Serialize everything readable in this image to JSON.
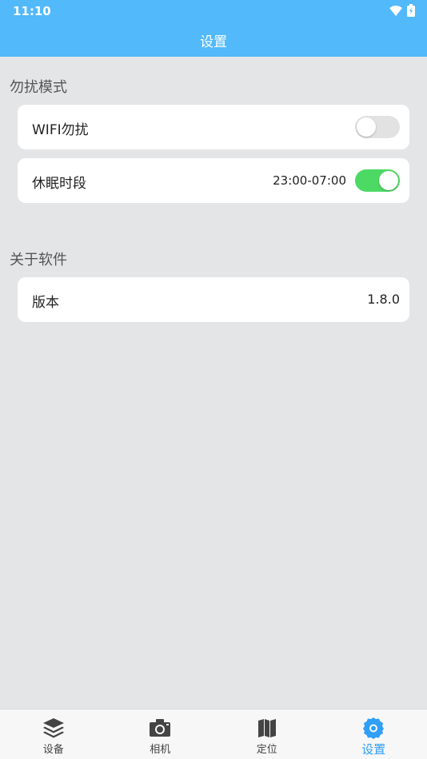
{
  "status": {
    "time": "11:10"
  },
  "header": {
    "title": "设置"
  },
  "sections": [
    {
      "title": "勿扰模式"
    },
    {
      "title": "关于软件"
    }
  ],
  "dnd": {
    "wifi": {
      "label": "WIFI勿扰",
      "enabled": false
    },
    "sleep": {
      "label": "休眠时段",
      "time_range": "23:00-07:00",
      "enabled": true
    }
  },
  "about": {
    "version": {
      "label": "版本",
      "value": "1.8.0"
    }
  },
  "nav": {
    "items": [
      {
        "label": "设备",
        "icon": "layers-icon"
      },
      {
        "label": "相机",
        "icon": "camera-icon"
      },
      {
        "label": "定位",
        "icon": "map-icon"
      },
      {
        "label": "设置",
        "icon": "gear-icon",
        "active": true
      }
    ]
  },
  "colors": {
    "header": "#52b9fb",
    "toggle_on": "#4cd964",
    "nav_active": "#2f9ff8"
  }
}
